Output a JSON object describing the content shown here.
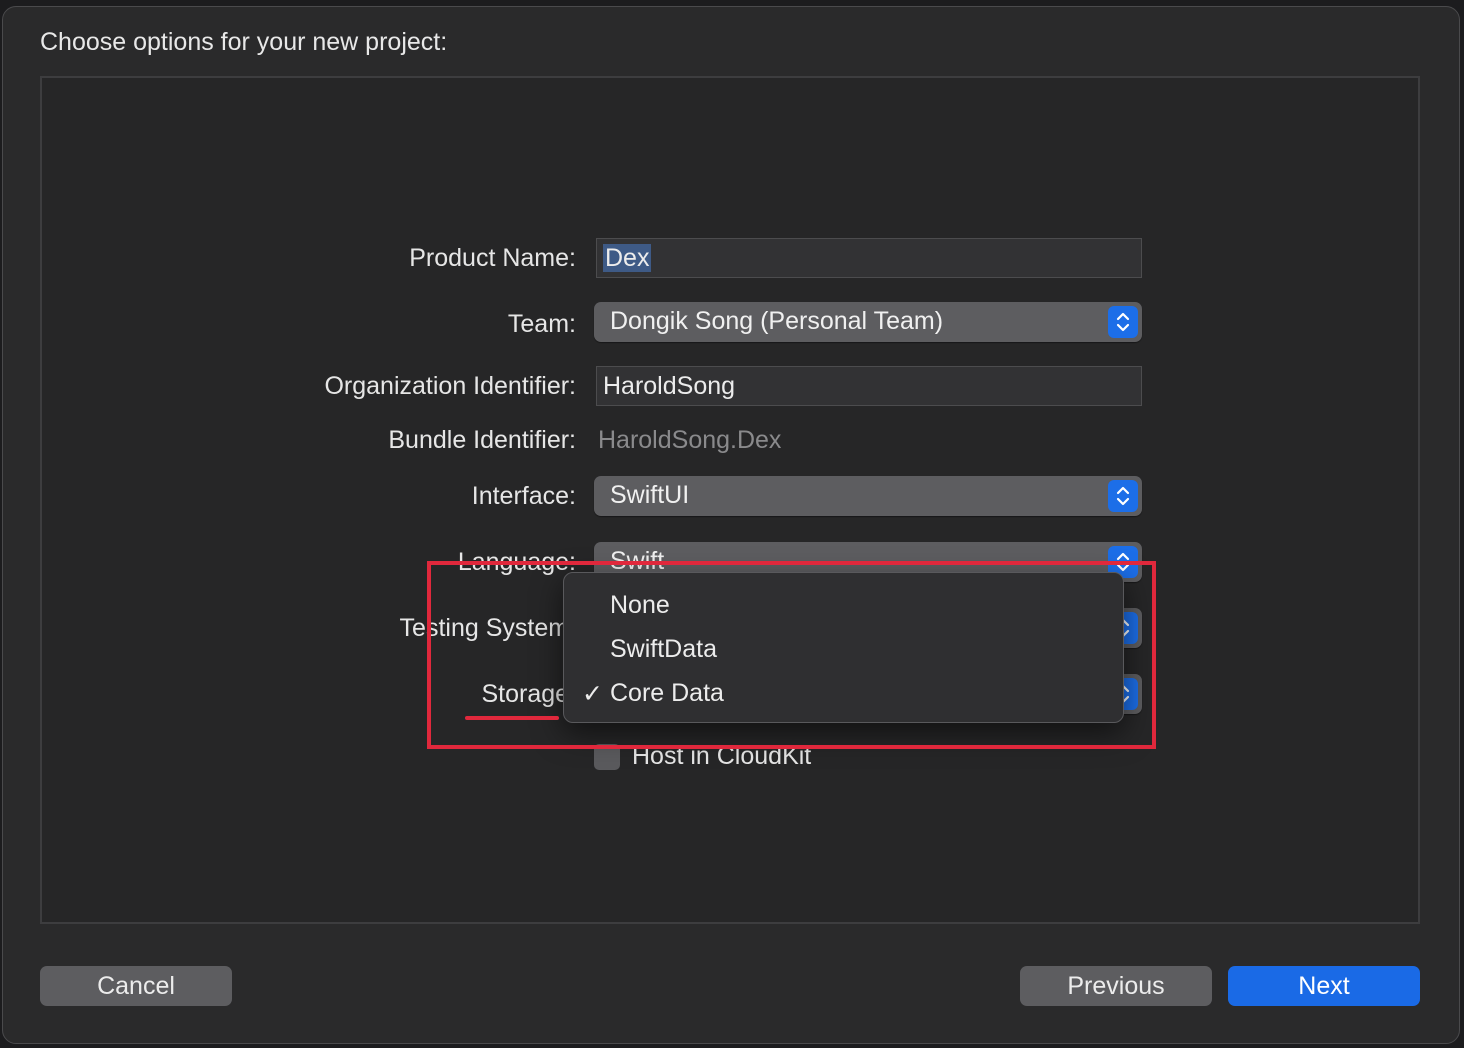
{
  "dialog": {
    "heading": "Choose options for your new project:"
  },
  "form": {
    "product_name": {
      "label": "Product Name:",
      "value": "Dex"
    },
    "team": {
      "label": "Team:",
      "value": "Dongik Song (Personal Team)"
    },
    "organization_identifier": {
      "label": "Organization Identifier:",
      "value": "HaroldSong"
    },
    "bundle_identifier": {
      "label": "Bundle Identifier:",
      "value": "HaroldSong.Dex"
    },
    "interface": {
      "label": "Interface:",
      "value": "SwiftUI"
    },
    "language": {
      "label": "Language:",
      "value": "Swift"
    },
    "testing_system": {
      "label": "Testing System:"
    },
    "storage": {
      "label": "Storage:"
    },
    "host_in_cloudkit": {
      "label": "Host in CloudKit",
      "checked": false
    }
  },
  "storage_menu": {
    "items": [
      {
        "label": "None",
        "checked": false
      },
      {
        "label": "SwiftData",
        "checked": false
      },
      {
        "label": "Core Data",
        "checked": true
      }
    ],
    "checkmark": "✓"
  },
  "buttons": {
    "cancel": "Cancel",
    "previous": "Previous",
    "next": "Next"
  },
  "colors": {
    "accent": "#1a6ae6",
    "annotation": "#e0283c"
  },
  "icons": {
    "popup_stepper": "up-down-chevron-icon"
  }
}
